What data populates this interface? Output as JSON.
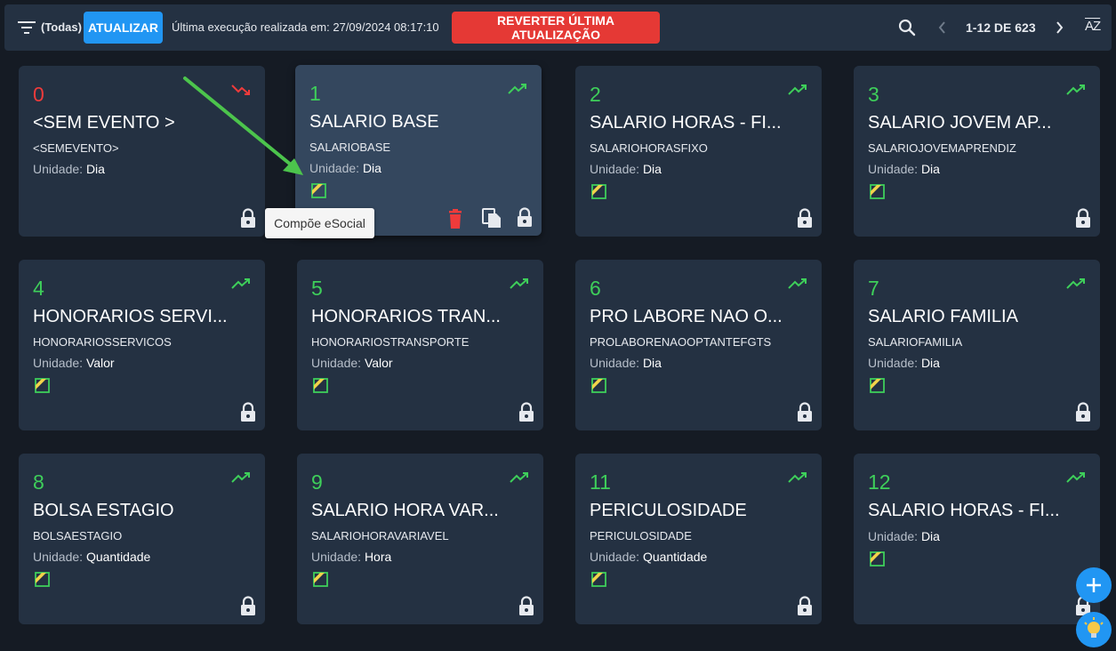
{
  "toolbar": {
    "filter_label": "(Todas)",
    "update_label": "ATUALIZAR",
    "last_exec": "Última execução realizada em: 27/09/2024 08:17:10",
    "revert_label": "REVERTER ÚLTIMA ATUALIZAÇÃO",
    "pager": "1-12 DE 623",
    "sort_label": "AZ"
  },
  "tooltip": "Compõe eSocial",
  "unit_label": "Unidade:",
  "colors": {
    "green": "#3ecf5a",
    "red": "#ef3b3b",
    "blue": "#2196f3"
  },
  "cards": [
    {
      "num": "0",
      "name": "<SEM EVENTO >",
      "code": "<SEMEVENTO>",
      "unit": "Dia",
      "trend": "down",
      "esocial": false
    },
    {
      "num": "1",
      "name": "SALARIO BASE",
      "code": "SALARIOBASE",
      "unit": "Dia",
      "trend": "up",
      "esocial": true
    },
    {
      "num": "2",
      "name": "SALARIO HORAS - FI...",
      "code": "SALARIOHORASFIXO",
      "unit": "Dia",
      "trend": "up",
      "esocial": true
    },
    {
      "num": "3",
      "name": "SALARIO JOVEM AP...",
      "code": "SALARIOJOVEMAPRENDIZ",
      "unit": "Dia",
      "trend": "up",
      "esocial": true
    },
    {
      "num": "4",
      "name": "HONORARIOS SERVI...",
      "code": "HONORARIOSSERVICOS",
      "unit": "Valor",
      "trend": "up",
      "esocial": true
    },
    {
      "num": "5",
      "name": "HONORARIOS TRAN...",
      "code": "HONORARIOSTRANSPORTE",
      "unit": "Valor",
      "trend": "up",
      "esocial": true
    },
    {
      "num": "6",
      "name": "PRO LABORE NAO O...",
      "code": "PROLABORENAOOPTANTEFGTS",
      "unit": "Dia",
      "trend": "up",
      "esocial": true
    },
    {
      "num": "7",
      "name": "SALARIO FAMILIA",
      "code": "SALARIOFAMILIA",
      "unit": "Dia",
      "trend": "up",
      "esocial": true
    },
    {
      "num": "8",
      "name": "BOLSA ESTAGIO",
      "code": "BOLSAESTAGIO",
      "unit": "Quantidade",
      "trend": "up",
      "esocial": true
    },
    {
      "num": "9",
      "name": "SALARIO HORA VAR...",
      "code": "SALARIOHORAVARIAVEL",
      "unit": "Hora",
      "trend": "up",
      "esocial": true
    },
    {
      "num": "11",
      "name": "PERICULOSIDADE",
      "code": "PERICULOSIDADE",
      "unit": "Quantidade",
      "trend": "up",
      "esocial": true
    },
    {
      "num": "12",
      "name": "SALARIO HORAS - FI...",
      "code": "",
      "unit": "Dia",
      "trend": "up",
      "esocial": true
    }
  ]
}
